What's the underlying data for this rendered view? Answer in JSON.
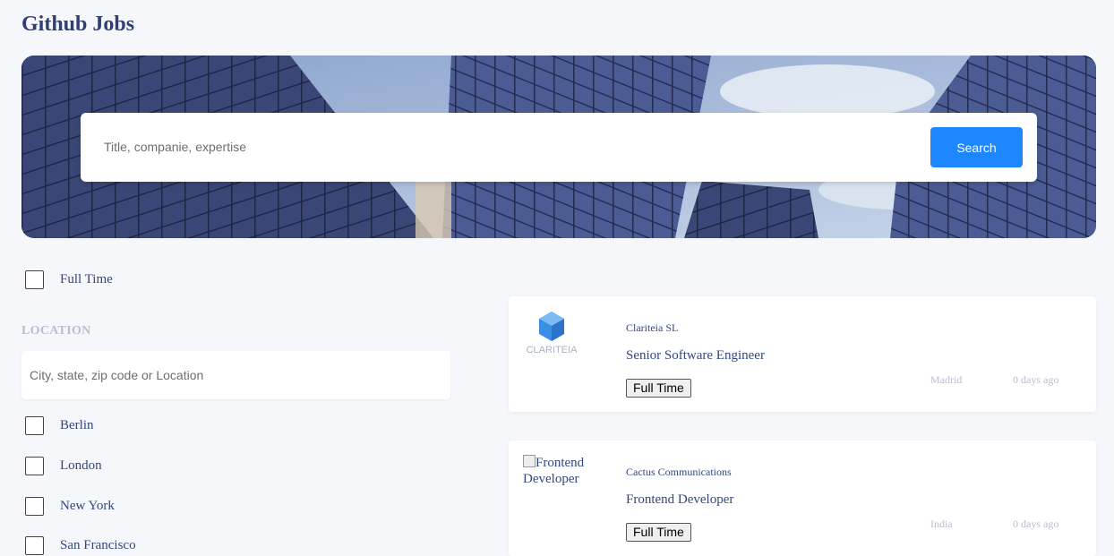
{
  "app": {
    "title": "Github Jobs"
  },
  "search": {
    "placeholder": "Title, companie, expertise",
    "value": "",
    "button_label": "Search"
  },
  "filters": {
    "full_time_label": "Full Time",
    "location_heading": "LOCATION",
    "location_placeholder": "City, state, zip code or Location",
    "locations": [
      {
        "label": "Berlin"
      },
      {
        "label": "London"
      },
      {
        "label": "New York"
      },
      {
        "label": "San Francisco"
      }
    ]
  },
  "jobs": [
    {
      "company": "Clariteia SL",
      "logo_text": "CLARITEIA",
      "title": "Senior Software Engineer",
      "type": "Full Time",
      "location": "Madrid",
      "posted": "0 days ago"
    },
    {
      "company": "Cactus Communications",
      "logo_alt": "Frontend Developer",
      "title": "Frontend Developer",
      "type": "Full Time",
      "location": "India",
      "posted": "0 days ago"
    }
  ],
  "colors": {
    "accent": "#1e86ff",
    "title": "#334680",
    "muted": "#b9bdcf"
  }
}
